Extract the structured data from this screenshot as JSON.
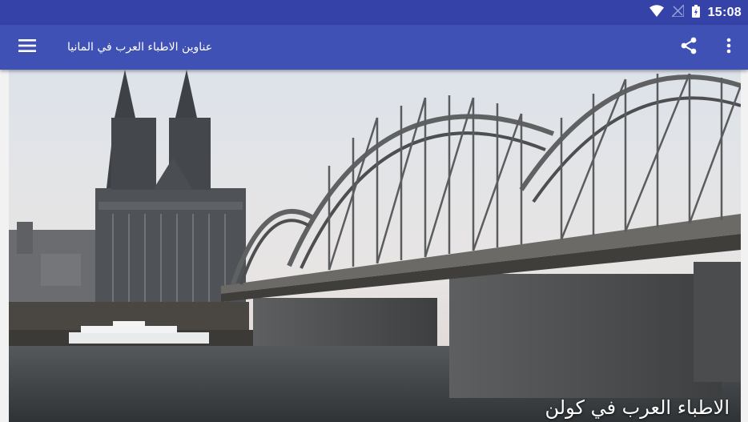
{
  "status_bar": {
    "time": "15:08",
    "icons": [
      "wifi-icon",
      "signal-icon",
      "battery-icon"
    ]
  },
  "app_bar": {
    "title": "عناوين الاطباء العرب في المانيا",
    "icons": [
      "menu-icon",
      "share-icon",
      "more-vert-icon"
    ],
    "color": "#3f51b5"
  },
  "card": {
    "caption": "الاطباء العرب في كولن",
    "image": "cologne-cathedral-hohenzollern-bridge"
  },
  "colors": {
    "status_bar": "#3543a8",
    "app_bar": "#3f51b5"
  }
}
